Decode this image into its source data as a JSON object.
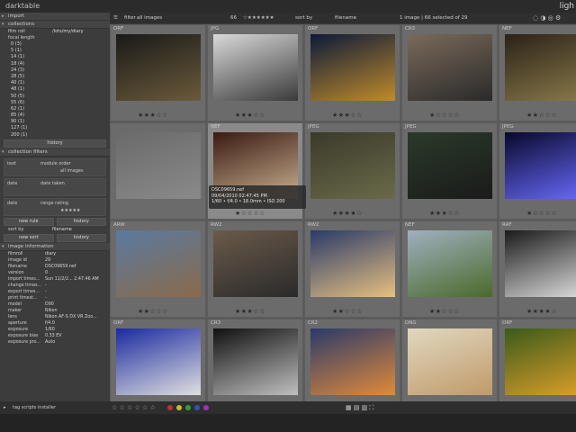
{
  "app": {
    "logo": "darktable",
    "name_right": "ligh"
  },
  "left": {
    "import_label": "import",
    "collections_label": "collections",
    "film_roll_key": "film roll",
    "film_roll_value": "/lots/my/diary",
    "focal_length_key": "focal length",
    "focal_list": [
      "0 (3)",
      "5 (1)",
      "14 (1)",
      "18 (4)",
      "24 (3)",
      "28 (5)",
      "40 (1)",
      "48 (1)",
      "50 (5)",
      "55 (6)",
      "62 (1)",
      "85 (4)",
      "90 (1)",
      "127 (1)",
      "200 (1)"
    ],
    "history_btn": "history",
    "collection_filters_label": "collection filters",
    "rule1_a": "text",
    "rule1_b": "module order",
    "rule1_c": "all images",
    "rule2_a": "date",
    "rule2_b": "date taken",
    "rule3_a": "date",
    "rule3_b": "range rating",
    "new_rule_btn": "new rule",
    "history_btn2": "history",
    "sort_by_key": "sort by",
    "sort_by_value": "filename",
    "new_sort_btn": "new sort",
    "history_btn3": "history",
    "image_info_label": "image information",
    "info": [
      {
        "k": "filmroll",
        "v": "diary"
      },
      {
        "k": "image id",
        "v": "29"
      },
      {
        "k": "filename",
        "v": "DSC09659.nef"
      },
      {
        "k": "version",
        "v": "0"
      },
      {
        "k": "import times...",
        "v": "Sun 11/2/2... 2:47:46 AM"
      },
      {
        "k": "change times...",
        "v": "-"
      },
      {
        "k": "export times...",
        "v": "-"
      },
      {
        "k": "print timest...",
        "v": "-"
      },
      {
        "k": "model",
        "v": "D90"
      },
      {
        "k": "maker",
        "v": "Nikon"
      },
      {
        "k": "lens",
        "v": "Nikon AF-S DX VR Zoo..."
      },
      {
        "k": "aperture",
        "v": "f/4.0"
      },
      {
        "k": "exposure",
        "v": "1/60"
      },
      {
        "k": "exposure bias",
        "v": "0.33 EV"
      },
      {
        "k": "exposure pro...",
        "v": "Auto"
      }
    ],
    "tag_label": "tag scripts installer"
  },
  "filterbar": {
    "filter_label": "filter",
    "filter_value": "all images",
    "count_prefix": "66",
    "sort_label": "sort by",
    "sort_value": "filename",
    "status": "1 image | 66 selected of 29"
  },
  "tooltip": {
    "line1": "DSC09659.nef",
    "line2": "09/04/2010 02:47:45 PM",
    "line3": "1/60 • f/4.0 • 18.0mm • ISO 200"
  },
  "thumbs": [
    {
      "ext": "ORF",
      "stars": "★★★☆☆",
      "colors": [
        "#1a1a1a",
        "#6a5a3a"
      ]
    },
    {
      "ext": "JPG",
      "stars": "★★★☆☆",
      "colors": [
        "#d9d9d9",
        "#3a3a3a"
      ]
    },
    {
      "ext": "ORF",
      "stars": "★★★☆☆",
      "colors": [
        "#0c1a3a",
        "#c08a2a"
      ]
    },
    {
      "ext": "CR3",
      "stars": "★☆☆☆☆",
      "colors": [
        "#7a6a5a",
        "#2a2a2a"
      ]
    },
    {
      "ext": "NEF",
      "stars": "★★☆☆☆",
      "colors": [
        "#2a2218",
        "#8a7a4a"
      ]
    },
    {
      "ext": "",
      "stars": "",
      "colors": [
        "#6a6a6a",
        "#8a8a8a"
      ]
    },
    {
      "ext": "NEF",
      "stars": "★☆☆☆☆",
      "colors": [
        "#3a1a12",
        "#c8b090"
      ]
    },
    {
      "ext": "JPEG",
      "stars": "★★★★☆",
      "colors": [
        "#3a3a2a",
        "#6a6a4a"
      ]
    },
    {
      "ext": "JPEG",
      "stars": "★★★☆☆",
      "colors": [
        "#2a3a2a",
        "#1a1a1a"
      ]
    },
    {
      "ext": "JPEG",
      "stars": "★☆☆☆☆",
      "colors": [
        "#08082a",
        "#6a6aff"
      ]
    },
    {
      "ext": "ARW",
      "stars": "★★☆☆☆",
      "colors": [
        "#5a7aa0",
        "#8a6a4a"
      ]
    },
    {
      "ext": "RW2",
      "stars": "★★★☆☆",
      "colors": [
        "#6a5a4a",
        "#2a2a2a"
      ]
    },
    {
      "ext": "RW2",
      "stars": "★★☆☆☆",
      "colors": [
        "#2a3a6a",
        "#e6c080"
      ]
    },
    {
      "ext": "NEF",
      "stars": "★★☆☆☆",
      "colors": [
        "#a0b0c0",
        "#4a6a2a"
      ]
    },
    {
      "ext": "RAF",
      "stars": "★★★★☆",
      "colors": [
        "#1a1a1a",
        "#e0e0e0"
      ]
    },
    {
      "ext": "ORF",
      "stars": "",
      "colors": [
        "#1a2aa0",
        "#e0e0e0"
      ]
    },
    {
      "ext": "CR3",
      "stars": "",
      "colors": [
        "#101010",
        "#c0c0c0"
      ]
    },
    {
      "ext": "CR2",
      "stars": "",
      "colors": [
        "#2a3a6a",
        "#e08a3a"
      ]
    },
    {
      "ext": "DNG",
      "stars": "",
      "colors": [
        "#e0d8c0",
        "#c09a6a"
      ]
    },
    {
      "ext": "ORF",
      "stars": "",
      "colors": [
        "#3a5a1a",
        "#e0a02a"
      ]
    }
  ],
  "bottombar": {
    "label_left": "tag scripts installer"
  }
}
